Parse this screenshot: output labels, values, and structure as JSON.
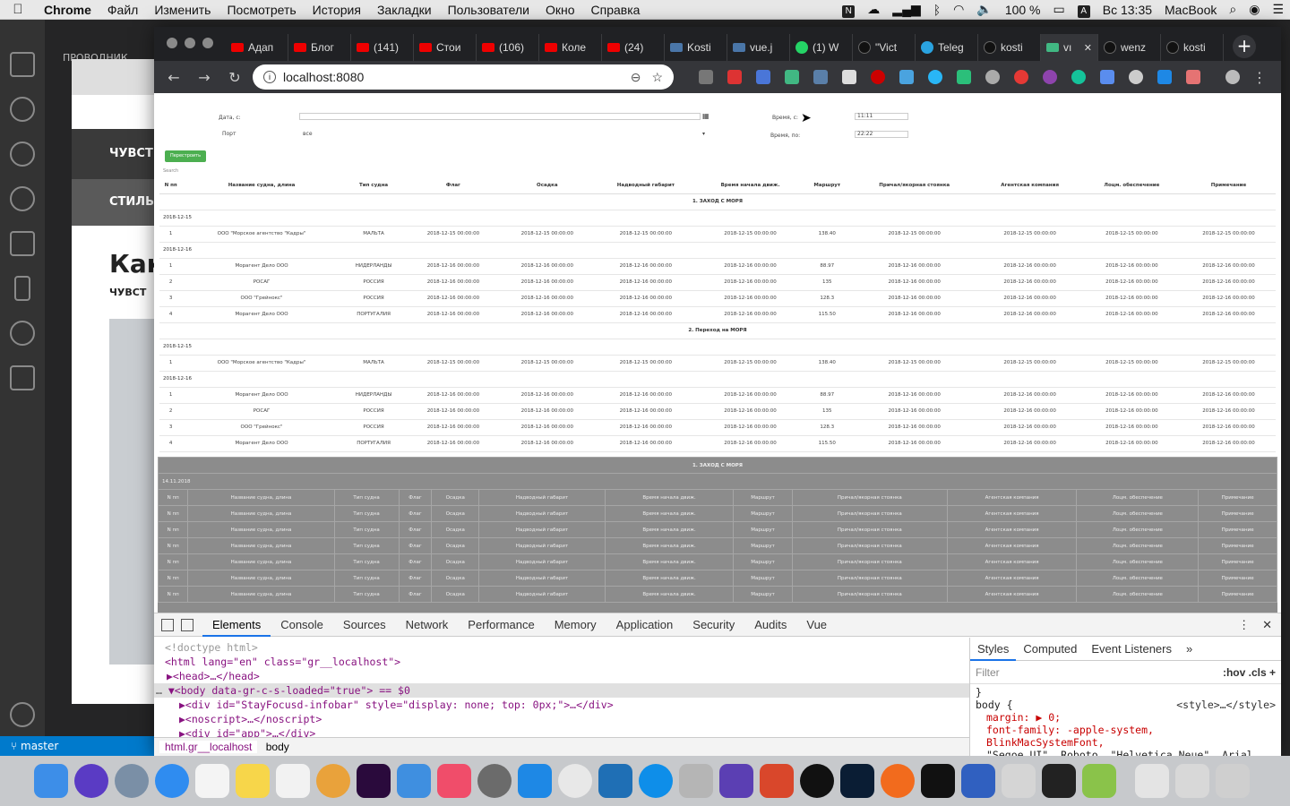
{
  "menubar": {
    "app": "Chrome",
    "items": [
      "Файл",
      "Изменить",
      "Посмотреть",
      "История",
      "Закладки",
      "Пользователи",
      "Окно",
      "Справка"
    ],
    "battery": "100 %",
    "datetime": "Вс 13:35",
    "computer": "MacBook",
    "input_letter": "A",
    "n_letter": "N"
  },
  "vscode": {
    "branch": "master",
    "explorer_label": "ПРОВОДНИК"
  },
  "back_window": {
    "bar1": "ЧУВСТ",
    "bar2": "СТИЛЬ",
    "heading": "Как",
    "subheading": "ЧУВСТ"
  },
  "tabs": [
    {
      "label": "Адап",
      "favicon": "youtube"
    },
    {
      "label": "Блог",
      "favicon": "youtube"
    },
    {
      "label": "(141)",
      "favicon": "youtube"
    },
    {
      "label": "Стои",
      "favicon": "youtube"
    },
    {
      "label": "(106)",
      "favicon": "youtube"
    },
    {
      "label": "Коле",
      "favicon": "youtube"
    },
    {
      "label": "(24)",
      "favicon": "youtube"
    },
    {
      "label": "Kosti",
      "favicon": "vk"
    },
    {
      "label": "vue.j",
      "favicon": "vk"
    },
    {
      "label": "(1) W",
      "favicon": "whatsapp"
    },
    {
      "label": "\"Vict",
      "favicon": "play"
    },
    {
      "label": "Teleg",
      "favicon": "telegram"
    },
    {
      "label": "kosti",
      "favicon": "github"
    },
    {
      "label": "vı",
      "favicon": "vue",
      "active": true
    },
    {
      "label": "wenz",
      "favicon": "github"
    },
    {
      "label": "kosti",
      "favicon": "github"
    }
  ],
  "url": "localhost:8080",
  "form": {
    "date_from_label": "Дата, с:",
    "port_label": "Порт",
    "port_value": "все",
    "time_from_label": "Время, с:",
    "time_from_value": "11:11",
    "time_to_label": "Время, по:",
    "time_to_value": "22:22",
    "rebuild_button": "Перестроить",
    "search_placeholder": "Search"
  },
  "table": {
    "headers": [
      "N пп",
      "Название судна, длина",
      "Тип судна",
      "Флаг",
      "Осадка",
      "Надводный габарит",
      "Время начала движ.",
      "Маршрут",
      "Причал/якорная стоянка",
      "Агентская компания",
      "Лоцм. обеспечение",
      "Примечание"
    ],
    "sections": [
      {
        "title": "1. ЗАХОД С МОРЯ",
        "groups": [
          {
            "date": "2018-12-15",
            "rows": [
              [
                "1",
                "ООО \"Морское агентство \"Кадры\"",
                "МАЛЬТА",
                "2018-12-15 00:00:00",
                "2018-12-15 00:00:00",
                "2018-12-15 00:00:00",
                "2018-12-15 00:00:00",
                "138.40",
                "2018-12-15 00:00:00",
                "2018-12-15 00:00:00",
                "2018-12-15 00:00:00",
                "2018-12-15 00:00:00"
              ]
            ]
          },
          {
            "date": "2018-12-16",
            "rows": [
              [
                "1",
                "Морагент Дело ООО",
                "НИДЕРЛАНДЫ",
                "2018-12-16 00:00:00",
                "2018-12-16 00:00:00",
                "2018-12-16 00:00:00",
                "2018-12-16 00:00:00",
                "88.97",
                "2018-12-16 00:00:00",
                "2018-12-16 00:00:00",
                "2018-12-16 00:00:00",
                "2018-12-16 00:00:00"
              ],
              [
                "2",
                "РОСАГ",
                "РОССИЯ",
                "2018-12-16 00:00:00",
                "2018-12-16 00:00:00",
                "2018-12-16 00:00:00",
                "2018-12-16 00:00:00",
                "135",
                "2018-12-16 00:00:00",
                "2018-12-16 00:00:00",
                "2018-12-16 00:00:00",
                "2018-12-16 00:00:00"
              ],
              [
                "3",
                "ООО \"Грейнокс\"",
                "РОССИЯ",
                "2018-12-16 00:00:00",
                "2018-12-16 00:00:00",
                "2018-12-16 00:00:00",
                "2018-12-16 00:00:00",
                "128.3",
                "2018-12-16 00:00:00",
                "2018-12-16 00:00:00",
                "2018-12-16 00:00:00",
                "2018-12-16 00:00:00"
              ],
              [
                "4",
                "Морагент Дело ООО",
                "ПОРТУГАЛИЯ",
                "2018-12-16 00:00:00",
                "2018-12-16 00:00:00",
                "2018-12-16 00:00:00",
                "2018-12-16 00:00:00",
                "115.50",
                "2018-12-16 00:00:00",
                "2018-12-16 00:00:00",
                "2018-12-16 00:00:00",
                "2018-12-16 00:00:00"
              ]
            ]
          }
        ]
      },
      {
        "title": "2. Переход на МОРЯ",
        "groups": [
          {
            "date": "2018-12-15",
            "rows": [
              [
                "1",
                "ООО \"Морское агентство \"Кадры\"",
                "МАЛЬТА",
                "2018-12-15 00:00:00",
                "2018-12-15 00:00:00",
                "2018-12-15 00:00:00",
                "2018-12-15 00:00:00",
                "138.40",
                "2018-12-15 00:00:00",
                "2018-12-15 00:00:00",
                "2018-12-15 00:00:00",
                "2018-12-15 00:00:00"
              ]
            ]
          },
          {
            "date": "2018-12-16",
            "rows": [
              [
                "1",
                "Морагент Дело ООО",
                "НИДЕРЛАНДЫ",
                "2018-12-16 00:00:00",
                "2018-12-16 00:00:00",
                "2018-12-16 00:00:00",
                "2018-12-16 00:00:00",
                "88.97",
                "2018-12-16 00:00:00",
                "2018-12-16 00:00:00",
                "2018-12-16 00:00:00",
                "2018-12-16 00:00:00"
              ],
              [
                "2",
                "РОСАГ",
                "РОССИЯ",
                "2018-12-16 00:00:00",
                "2018-12-16 00:00:00",
                "2018-12-16 00:00:00",
                "2018-12-16 00:00:00",
                "135",
                "2018-12-16 00:00:00",
                "2018-12-16 00:00:00",
                "2018-12-16 00:00:00",
                "2018-12-16 00:00:00"
              ],
              [
                "3",
                "ООО \"Грейнокс\"",
                "РОССИЯ",
                "2018-12-16 00:00:00",
                "2018-12-16 00:00:00",
                "2018-12-16 00:00:00",
                "2018-12-16 00:00:00",
                "128.3",
                "2018-12-16 00:00:00",
                "2018-12-16 00:00:00",
                "2018-12-16 00:00:00",
                "2018-12-16 00:00:00"
              ],
              [
                "4",
                "Морагент Дело ООО",
                "ПОРТУГАЛИЯ",
                "2018-12-16 00:00:00",
                "2018-12-16 00:00:00",
                "2018-12-16 00:00:00",
                "2018-12-16 00:00:00",
                "115.50",
                "2018-12-16 00:00:00",
                "2018-12-16 00:00:00",
                "2018-12-16 00:00:00",
                "2018-12-16 00:00:00"
              ]
            ]
          }
        ]
      }
    ]
  },
  "gray_table": {
    "title": "1. ЗАХОД С МОРЯ",
    "date": "14.11.2018",
    "headers": [
      "N пп",
      "Название судна, длина",
      "Тип судна",
      "Флаг",
      "Осадка",
      "Надводный габарит",
      "Время начала движ.",
      "Маршрут",
      "Причал/якорная стоянка",
      "Агентская компания",
      "Лоцм. обеспечение",
      "Примечание"
    ],
    "row_count": 7
  },
  "devtools": {
    "tabs": [
      "Elements",
      "Console",
      "Sources",
      "Network",
      "Performance",
      "Memory",
      "Application",
      "Security",
      "Audits",
      "Vue"
    ],
    "active_tab": "Elements",
    "lines": [
      "<!doctype html>",
      "<html lang=\"en\" class=\"gr__localhost\">",
      "▶<head>…</head>",
      "▼<body data-gr-c-s-loaded=\"true\"> == $0",
      "▶<div id=\"StayFocusd-infobar\" style=\"display: none; top: 0px;\">…</div>",
      "▶<noscript>…</noscript>",
      "▶<div id=\"app\">…</div>"
    ],
    "crumbs": [
      "html.gr__localhost",
      "body"
    ],
    "styles_tabs": [
      "Styles",
      "Computed",
      "Event Listeners",
      "»"
    ],
    "filter_placeholder": "Filter",
    "filter_opts": ":hov  .cls  +",
    "rule_selector": "body {",
    "rule_source": "<style>…</style>",
    "rule_props": [
      "margin: ▶ 0;",
      "font-family: -apple-system, BlinkMacSystemFont,",
      "  \"Segoe UI\", Roboto, \"Helvetica Neue\", Arial,"
    ]
  },
  "colors": {
    "accent_green": "#4caf50",
    "chrome_dark": "#202124",
    "devtools_blue": "#1a73e8",
    "vscode_blue": "#007acc"
  }
}
